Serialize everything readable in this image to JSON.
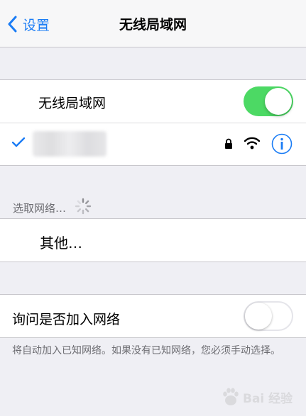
{
  "nav": {
    "back_label": "设置",
    "title": "无线局域网"
  },
  "wifi": {
    "label": "无线局域网",
    "enabled": true,
    "connected_network_name": ""
  },
  "choose_network": {
    "header": "选取网络…",
    "other_label": "其他…"
  },
  "ask_to_join": {
    "label": "询问是否加入网络",
    "enabled": false,
    "footer": "将自动加入已知网络。如果没有已知网络，您必须手动选择。"
  },
  "colors": {
    "accent": "#1a7cf5",
    "toggle_on": "#4cd964",
    "background": "#efeff4"
  }
}
